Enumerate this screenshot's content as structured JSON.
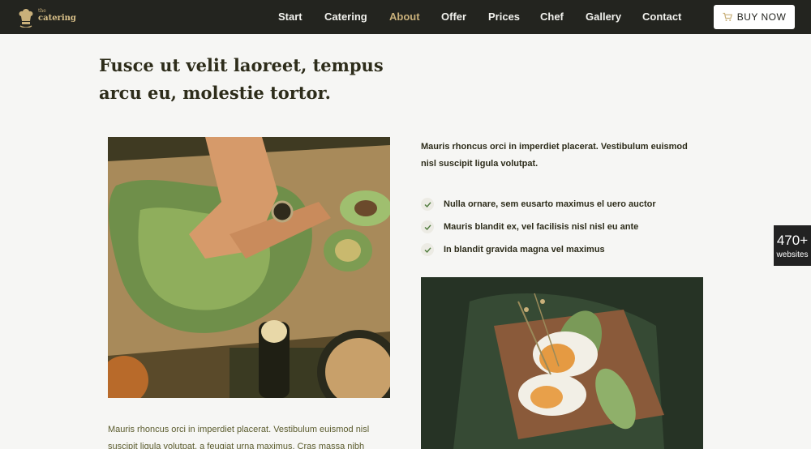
{
  "brand": {
    "small": "the",
    "name": "catering"
  },
  "nav": {
    "items": [
      {
        "label": "Start"
      },
      {
        "label": "Catering"
      },
      {
        "label": "About"
      },
      {
        "label": "Offer"
      },
      {
        "label": "Prices"
      },
      {
        "label": "Chef"
      },
      {
        "label": "Gallery"
      },
      {
        "label": "Contact"
      }
    ],
    "active": "About",
    "buy_label": "BUY NOW"
  },
  "headline": "Fusce ut velit laoreet, tempus arcu eu, molestie tortor.",
  "intro": "Mauris rhoncus orci in imperdiet placerat. Vestibulum euismod nisl suscipit ligula volutpat.",
  "features": [
    "Nulla ornare, sem eusarto maximus el uero auctor",
    "Mauris blandit ex, vel facilisis nisl nisl eu ante",
    "In blandit gravida magna vel maximus"
  ],
  "body_text": "Mauris rhoncus orci in imperdiet placerat. Vestibulum euismod nisl suscipit ligula volutpat, a feugiat urna maximus. Cras massa nibh",
  "badge": {
    "count": "470+",
    "label": "websites"
  },
  "images": {
    "left": "food-preparation-photo",
    "right": "egg-avocado-toast-photo"
  },
  "icons": {
    "cart": "cart-icon",
    "check": "check-icon",
    "logo": "chef-hat-icon"
  },
  "colors": {
    "nav_bg": "#23241f",
    "accent_gold": "#c9b07a",
    "heading": "#2d2c1a",
    "body_text": "#5b5c2e",
    "check_green": "#4d7a3a",
    "page_bg": "#f6f6f4"
  }
}
